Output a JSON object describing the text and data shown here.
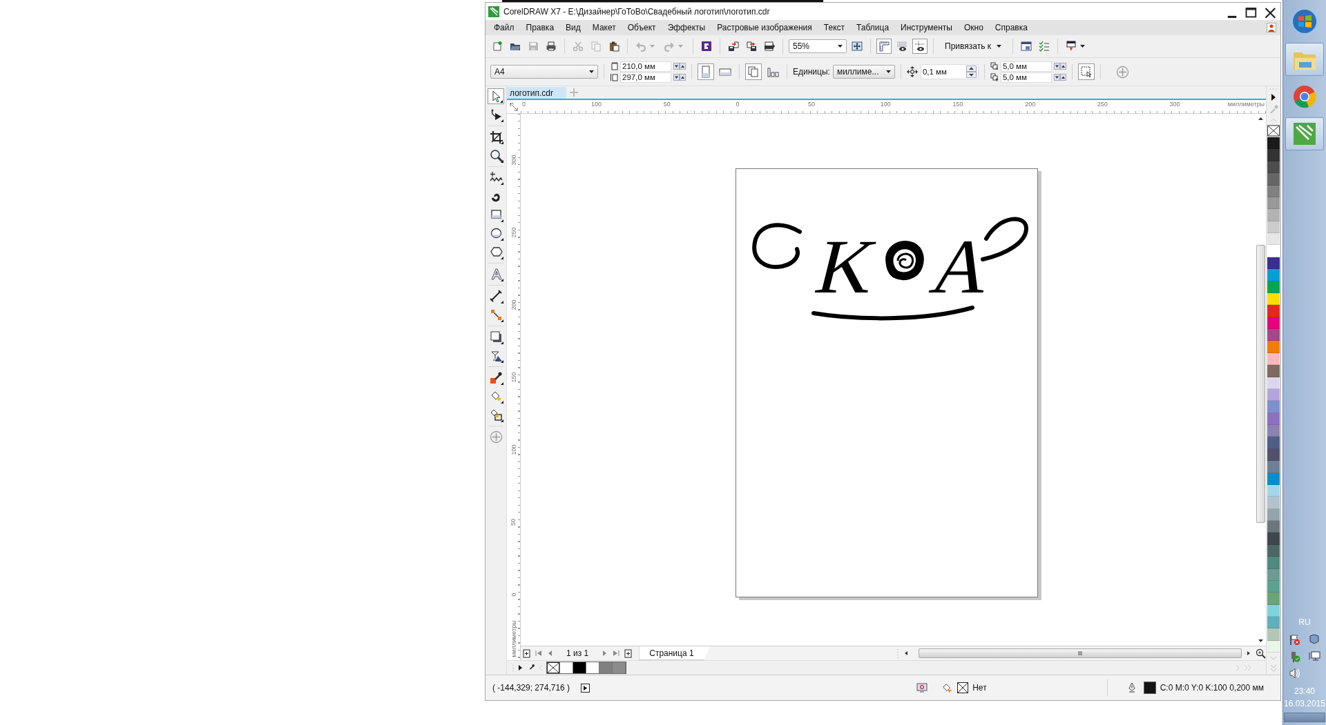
{
  "window": {
    "title": "CorelDRAW X7 - E:\\Дизайнер\\ГоТоВо\\Свадебный логотип\\логотип.cdr"
  },
  "menu": [
    "Файл",
    "Правка",
    "Вид",
    "Макет",
    "Объект",
    "Эффекты",
    "Растровые изображения",
    "Текст",
    "Таблица",
    "Инструменты",
    "Окно",
    "Справка"
  ],
  "toolbar": [
    {
      "kind": "new",
      "disabled": false
    },
    {
      "kind": "open",
      "disabled": false
    },
    {
      "kind": "save",
      "disabled": true
    },
    {
      "kind": "print",
      "disabled": false
    },
    {
      "kind": "sep"
    },
    {
      "kind": "cut",
      "disabled": true
    },
    {
      "kind": "copy",
      "disabled": true
    },
    {
      "kind": "paste",
      "disabled": false
    },
    {
      "kind": "sep"
    },
    {
      "kind": "undo",
      "disabled": true
    },
    {
      "kind": "redo",
      "disabled": true
    },
    {
      "kind": "sep"
    },
    {
      "kind": "connect",
      "disabled": false
    },
    {
      "kind": "sep"
    },
    {
      "kind": "import",
      "disabled": false
    },
    {
      "kind": "export",
      "disabled": false
    },
    {
      "kind": "pdf",
      "disabled": false
    },
    {
      "kind": "sep"
    },
    {
      "kind": "zoom",
      "value": "55%"
    },
    {
      "kind": "fit",
      "disabled": false
    },
    {
      "kind": "sep"
    },
    {
      "kind": "rulers",
      "on": true
    },
    {
      "kind": "grid",
      "on": false
    },
    {
      "kind": "guides",
      "on": true
    },
    {
      "kind": "sep"
    },
    {
      "kind": "snap",
      "label": "Привязать к"
    },
    {
      "kind": "sep"
    },
    {
      "kind": "options",
      "disabled": false
    },
    {
      "kind": "checklist",
      "disabled": false
    },
    {
      "kind": "sep"
    },
    {
      "kind": "launcher",
      "disabled": false
    }
  ],
  "property_bar": {
    "page_size": "A4",
    "width": "210,0 мм",
    "height": "297,0 мм",
    "orientations": [
      {
        "kind": "portrait",
        "selected": true
      },
      {
        "kind": "landscape",
        "selected": false
      }
    ],
    "units_label": "Единицы:",
    "units": "миллиме...",
    "nudge": "0,1 мм",
    "duplicate_x": "5,0 мм",
    "duplicate_y": "5,0 мм"
  },
  "document_tabs": [
    {
      "label": "логотип.cdr",
      "selected": true
    }
  ],
  "toolbox": [
    {
      "tools": [
        {
          "kind": "pick",
          "selected": true
        },
        {
          "kind": "shape",
          "selected": false
        }
      ]
    },
    {
      "tools": [
        {
          "kind": "crop",
          "selected": false
        },
        {
          "kind": "zoom",
          "selected": false
        }
      ]
    },
    {
      "tools": [
        {
          "kind": "freehand",
          "selected": false
        },
        {
          "kind": "artistic",
          "selected": false
        },
        {
          "kind": "rectangle",
          "selected": false
        },
        {
          "kind": "ellipse",
          "selected": false
        },
        {
          "kind": "polygon",
          "selected": false
        }
      ]
    },
    {
      "tools": [
        {
          "kind": "text",
          "selected": false
        }
      ]
    },
    {
      "tools": [
        {
          "kind": "dimension",
          "selected": false
        },
        {
          "kind": "connector",
          "selected": false
        }
      ]
    },
    {
      "tools": [
        {
          "kind": "shadow",
          "selected": false
        },
        {
          "kind": "transparency",
          "selected": false
        }
      ]
    },
    {
      "tools": [
        {
          "kind": "eyedropper",
          "selected": false
        },
        {
          "kind": "fill",
          "selected": false
        },
        {
          "kind": "smartfill",
          "selected": false
        }
      ]
    },
    {
      "tools": [
        {
          "kind": "add",
          "selected": false
        }
      ]
    }
  ],
  "ruler_top": {
    "labels": [
      "0",
      "100",
      "50",
      "0",
      "50",
      "100",
      "150",
      "200",
      "250",
      "300"
    ],
    "unit": "миллиметры"
  },
  "ruler_left": {
    "labels": [
      "300",
      "250",
      "200",
      "150",
      "100",
      "50",
      "0"
    ],
    "unit": "миллиметры"
  },
  "monogram": {
    "letters": [
      "K",
      "A"
    ]
  },
  "page_navigator": {
    "counter": "1 из 1",
    "pages": [
      {
        "label": "Страница 1",
        "selected": true
      }
    ]
  },
  "document_palette": [
    {
      "kind": "none"
    },
    {
      "kind": "color",
      "color": "#ffffff"
    },
    {
      "kind": "color",
      "color": "#000000"
    },
    {
      "kind": "color",
      "color": "#ffffff"
    },
    {
      "kind": "color",
      "color": "#808080"
    },
    {
      "kind": "color",
      "color": "#8c8c8c"
    }
  ],
  "color_palette": [
    {
      "kind": "none"
    },
    {
      "kind": "color",
      "color": "#1a1a1a"
    },
    {
      "kind": "color",
      "color": "#333333"
    },
    {
      "kind": "color",
      "color": "#4d4d4d"
    },
    {
      "kind": "color",
      "color": "#666666"
    },
    {
      "kind": "color",
      "color": "#808080"
    },
    {
      "kind": "color",
      "color": "#999999"
    },
    {
      "kind": "color",
      "color": "#b3b3b3"
    },
    {
      "kind": "color",
      "color": "#cccccc"
    },
    {
      "kind": "color",
      "color": "#e6e6e6"
    },
    {
      "kind": "color",
      "color": "#ffffff"
    },
    {
      "kind": "color",
      "color": "#3a2e91"
    },
    {
      "kind": "color",
      "color": "#00a0d6"
    },
    {
      "kind": "color",
      "color": "#00a650"
    },
    {
      "kind": "color",
      "color": "#ffdd00"
    },
    {
      "kind": "color",
      "color": "#e3281e"
    },
    {
      "kind": "color",
      "color": "#e6007e"
    },
    {
      "kind": "color",
      "color": "#a84689"
    },
    {
      "kind": "color",
      "color": "#f07d00"
    },
    {
      "kind": "color",
      "color": "#f9b8bc"
    },
    {
      "kind": "color",
      "color": "#7f6a60"
    },
    {
      "kind": "color",
      "color": "#dcd6ef"
    },
    {
      "kind": "color",
      "color": "#b3a5de"
    },
    {
      "kind": "color",
      "color": "#7d8fcf"
    },
    {
      "kind": "color",
      "color": "#8d70c0"
    },
    {
      "kind": "color",
      "color": "#8c83b0"
    },
    {
      "kind": "color",
      "color": "#4f5e87"
    },
    {
      "kind": "color",
      "color": "#545069"
    },
    {
      "kind": "color",
      "color": "#6e7f98"
    },
    {
      "kind": "color",
      "color": "#0090d0"
    },
    {
      "kind": "color",
      "color": "#a4d5ea"
    },
    {
      "kind": "color",
      "color": "#b3c3cc"
    },
    {
      "kind": "color",
      "color": "#94a4ab"
    },
    {
      "kind": "color",
      "color": "#6b777d"
    },
    {
      "kind": "color",
      "color": "#3e484c"
    },
    {
      "kind": "color",
      "color": "#4e6763"
    },
    {
      "kind": "color",
      "color": "#4f8a7e"
    },
    {
      "kind": "color",
      "color": "#6c9b93"
    },
    {
      "kind": "color",
      "color": "#5aa390"
    },
    {
      "kind": "color",
      "color": "#6aa578"
    },
    {
      "kind": "color",
      "color": "#80d3db"
    },
    {
      "kind": "color",
      "color": "#5eb0bb"
    },
    {
      "kind": "color",
      "color": "#b3c7b8"
    },
    {
      "kind": "color",
      "color": "#e8f5e8"
    }
  ],
  "status_bar": {
    "cursor": "( -144,329; 274,716 )",
    "fill": "Нет",
    "outline_swatch": {
      "color": "#141414"
    },
    "outline": "C:0 M:0 Y:0 K:100  0,200 мм"
  },
  "taskbar": {
    "apps": [
      {
        "kind": "start"
      },
      {
        "kind": "explorer",
        "running": true
      },
      {
        "kind": "chrome",
        "running": false
      },
      {
        "kind": "corel",
        "running": true
      }
    ],
    "language": "RU",
    "time": "23:40",
    "date": "16.03.2015"
  }
}
